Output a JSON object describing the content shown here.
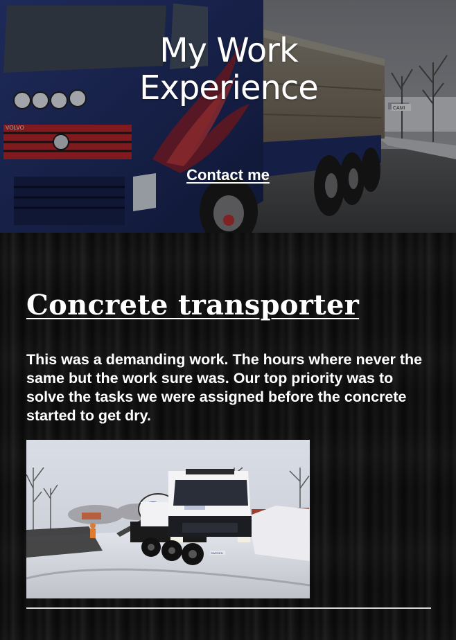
{
  "hero": {
    "title_line1": "My Work",
    "title_line2": "Experience",
    "contact_link": "Contact me",
    "truck_brand": "VOLVO",
    "sign_text": "CAMI"
  },
  "experience": {
    "title": "Concrete transporter",
    "description": "This was a demanding work. The hours where never the same but the work sure was. Our top priority was to solve the tasks we were assigned before the concrete started to get dry.",
    "photo_plate": "SWEDEN"
  },
  "colors": {
    "text": "#ffffff",
    "background": "#0d0d0d",
    "truck_blue": "#23336b",
    "truck_red": "#b3242b",
    "divider": "#d8d8d8"
  }
}
